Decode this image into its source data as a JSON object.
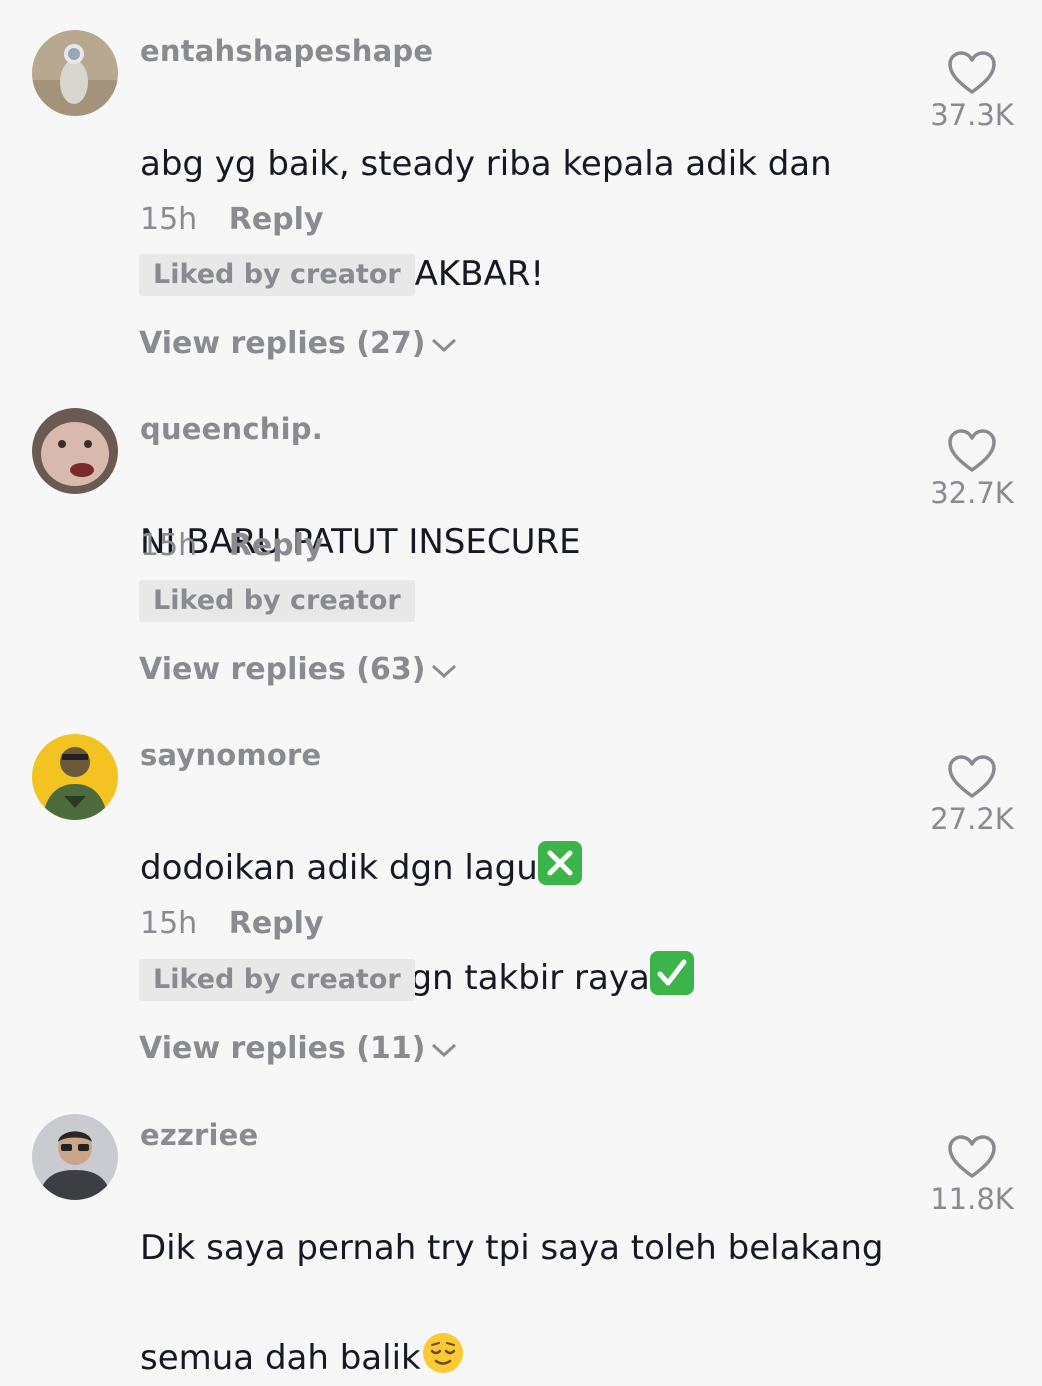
{
  "comments": [
    {
      "username": "entahshapeshape",
      "text_lines": [
        "abg yg baik, steady riba kepala adik dan",
        "takbir...ALLAHU AKBAR!"
      ],
      "time": "15h",
      "reply_label": "Reply",
      "badge": "Liked by creator",
      "view_replies": "View replies (27)",
      "likes": "37.3K"
    },
    {
      "username": "queenchip.",
      "text_lines": [
        "NI BARU PATUT INSECURE"
      ],
      "time": "15h",
      "reply_label": "Reply",
      "badge": "Liked by creator",
      "view_replies": "View replies (63)",
      "likes": "32.7K"
    },
    {
      "username": "saynomore",
      "text_lines": [
        "dodoikan adik dgn lagu",
        "dodoikan adik dgn takbir raya"
      ],
      "emojis": [
        "cross-mark-emoji",
        "check-mark-emoji"
      ],
      "time": "15h",
      "reply_label": "Reply",
      "badge": "Liked by creator",
      "view_replies": "View replies (11)",
      "likes": "27.2K"
    },
    {
      "username": "ezzriee",
      "text_lines": [
        "Dik saya pernah try tpi saya toleh belakang",
        "semua dah balik"
      ],
      "emojis": [
        "relieved-face-emoji"
      ],
      "likes": "11.8K"
    }
  ],
  "colors": {
    "background": "#f7f7f7",
    "text_primary": "#161823",
    "text_secondary": "#8a8b91",
    "badge_bg": "#e8e8e9",
    "emoji_green": "#3bb54a"
  },
  "icons": [
    "heart-outline-icon",
    "chevron-down-icon"
  ]
}
